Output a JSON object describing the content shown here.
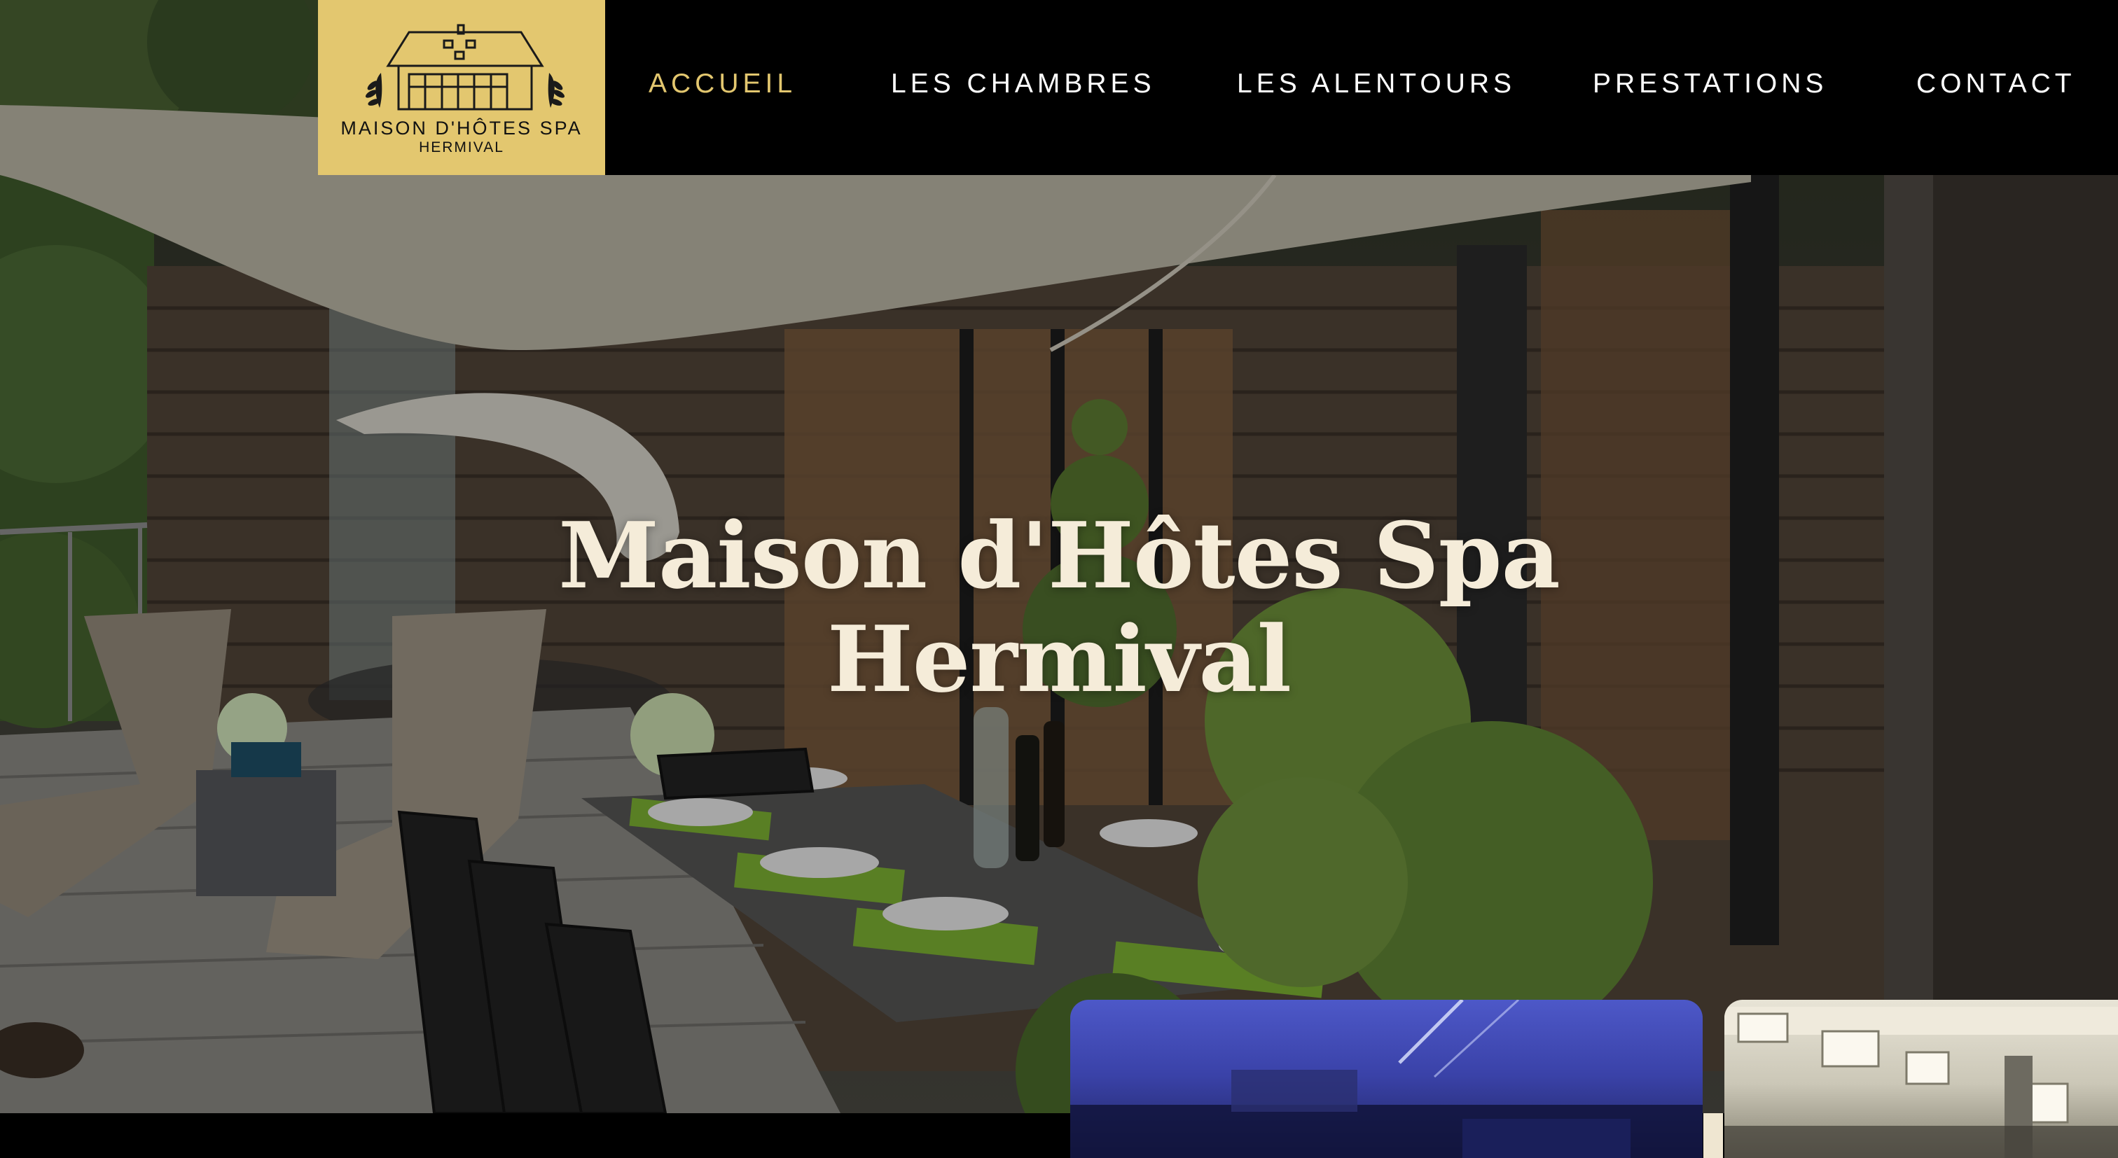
{
  "site": {
    "logo": {
      "line1": "MAISON D'HÔTES SPA",
      "line2": "HERMIVAL"
    },
    "brand_color": "#e3c76f"
  },
  "nav": {
    "items": [
      {
        "label": "ACCUEIL",
        "active": true
      },
      {
        "label": "LES CHAMBRES",
        "active": false
      },
      {
        "label": "LES ALENTOURS",
        "active": false
      },
      {
        "label": "PRESTATIONS",
        "active": false
      },
      {
        "label": "CONTACT",
        "active": false
      }
    ]
  },
  "hero": {
    "title_line1": "Maison d'Hôtes Spa",
    "title_line2": "Hermival",
    "title_color": "#f5ecd9"
  },
  "cards": [
    {
      "icon": "spa-photo"
    },
    {
      "icon": "room-photo"
    }
  ]
}
